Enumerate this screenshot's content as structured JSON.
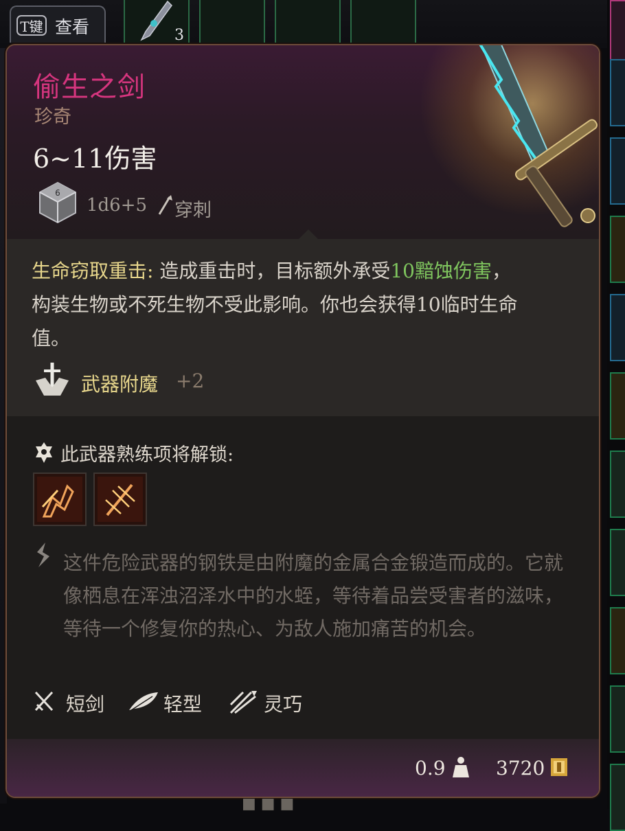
{
  "hotkey": {
    "key": "T键",
    "label": "查看"
  },
  "inventory": {
    "slot_count": "3"
  },
  "item": {
    "name": "偷生之剑",
    "rarity": "珍奇",
    "damage": "6~11伤害",
    "dice_formula": "1d6+5",
    "damage_type": "穿刺",
    "name_color": "#d6357e"
  },
  "passive": {
    "name": "生命窃取重击:",
    "text_before": " 造成重击时，目标额外承受",
    "highlight": "10黯蚀伤害",
    "text_after": "，构装生物或不死生物不受此影响。你也会获得10临时生命值。"
  },
  "enchantment": {
    "label": "武器附魔",
    "value": "+2"
  },
  "proficiency": {
    "label": "此武器熟练项将解锁:",
    "actions": [
      {
        "icon": "action-icon-1"
      },
      {
        "icon": "action-icon-2"
      }
    ]
  },
  "flavor_text": "这件危险武器的钢铁是由附魔的金属合金锻造而成的。它就像栖息在浑浊沼泽水中的水蛭，等待着品尝受害者的滋味，等待一个修复你的热心、为敌人施加痛苦的机会。",
  "properties": [
    {
      "label": "短剑",
      "icon": "crossed-swords-icon"
    },
    {
      "label": "轻型",
      "icon": "feather-icon"
    },
    {
      "label": "灵巧",
      "icon": "finesse-icon"
    }
  ],
  "footer": {
    "weight": "0.9",
    "value": "3720"
  }
}
